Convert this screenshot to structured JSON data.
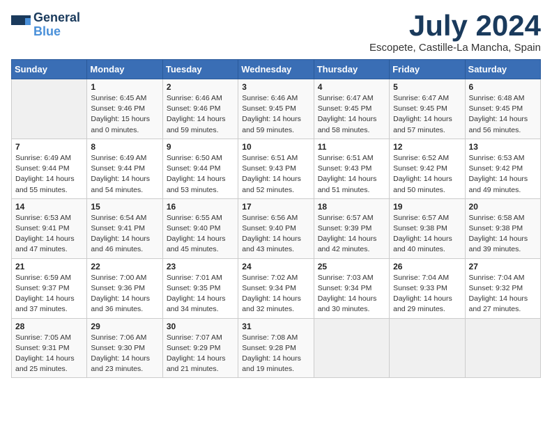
{
  "header": {
    "logo_line1": "General",
    "logo_line2": "Blue",
    "month": "July 2024",
    "location": "Escopete, Castille-La Mancha, Spain"
  },
  "weekdays": [
    "Sunday",
    "Monday",
    "Tuesday",
    "Wednesday",
    "Thursday",
    "Friday",
    "Saturday"
  ],
  "weeks": [
    [
      {
        "day": "",
        "info": ""
      },
      {
        "day": "1",
        "info": "Sunrise: 6:45 AM\nSunset: 9:46 PM\nDaylight: 15 hours\nand 0 minutes."
      },
      {
        "day": "2",
        "info": "Sunrise: 6:46 AM\nSunset: 9:46 PM\nDaylight: 14 hours\nand 59 minutes."
      },
      {
        "day": "3",
        "info": "Sunrise: 6:46 AM\nSunset: 9:45 PM\nDaylight: 14 hours\nand 59 minutes."
      },
      {
        "day": "4",
        "info": "Sunrise: 6:47 AM\nSunset: 9:45 PM\nDaylight: 14 hours\nand 58 minutes."
      },
      {
        "day": "5",
        "info": "Sunrise: 6:47 AM\nSunset: 9:45 PM\nDaylight: 14 hours\nand 57 minutes."
      },
      {
        "day": "6",
        "info": "Sunrise: 6:48 AM\nSunset: 9:45 PM\nDaylight: 14 hours\nand 56 minutes."
      }
    ],
    [
      {
        "day": "7",
        "info": "Sunrise: 6:49 AM\nSunset: 9:44 PM\nDaylight: 14 hours\nand 55 minutes."
      },
      {
        "day": "8",
        "info": "Sunrise: 6:49 AM\nSunset: 9:44 PM\nDaylight: 14 hours\nand 54 minutes."
      },
      {
        "day": "9",
        "info": "Sunrise: 6:50 AM\nSunset: 9:44 PM\nDaylight: 14 hours\nand 53 minutes."
      },
      {
        "day": "10",
        "info": "Sunrise: 6:51 AM\nSunset: 9:43 PM\nDaylight: 14 hours\nand 52 minutes."
      },
      {
        "day": "11",
        "info": "Sunrise: 6:51 AM\nSunset: 9:43 PM\nDaylight: 14 hours\nand 51 minutes."
      },
      {
        "day": "12",
        "info": "Sunrise: 6:52 AM\nSunset: 9:42 PM\nDaylight: 14 hours\nand 50 minutes."
      },
      {
        "day": "13",
        "info": "Sunrise: 6:53 AM\nSunset: 9:42 PM\nDaylight: 14 hours\nand 49 minutes."
      }
    ],
    [
      {
        "day": "14",
        "info": "Sunrise: 6:53 AM\nSunset: 9:41 PM\nDaylight: 14 hours\nand 47 minutes."
      },
      {
        "day": "15",
        "info": "Sunrise: 6:54 AM\nSunset: 9:41 PM\nDaylight: 14 hours\nand 46 minutes."
      },
      {
        "day": "16",
        "info": "Sunrise: 6:55 AM\nSunset: 9:40 PM\nDaylight: 14 hours\nand 45 minutes."
      },
      {
        "day": "17",
        "info": "Sunrise: 6:56 AM\nSunset: 9:40 PM\nDaylight: 14 hours\nand 43 minutes."
      },
      {
        "day": "18",
        "info": "Sunrise: 6:57 AM\nSunset: 9:39 PM\nDaylight: 14 hours\nand 42 minutes."
      },
      {
        "day": "19",
        "info": "Sunrise: 6:57 AM\nSunset: 9:38 PM\nDaylight: 14 hours\nand 40 minutes."
      },
      {
        "day": "20",
        "info": "Sunrise: 6:58 AM\nSunset: 9:38 PM\nDaylight: 14 hours\nand 39 minutes."
      }
    ],
    [
      {
        "day": "21",
        "info": "Sunrise: 6:59 AM\nSunset: 9:37 PM\nDaylight: 14 hours\nand 37 minutes."
      },
      {
        "day": "22",
        "info": "Sunrise: 7:00 AM\nSunset: 9:36 PM\nDaylight: 14 hours\nand 36 minutes."
      },
      {
        "day": "23",
        "info": "Sunrise: 7:01 AM\nSunset: 9:35 PM\nDaylight: 14 hours\nand 34 minutes."
      },
      {
        "day": "24",
        "info": "Sunrise: 7:02 AM\nSunset: 9:34 PM\nDaylight: 14 hours\nand 32 minutes."
      },
      {
        "day": "25",
        "info": "Sunrise: 7:03 AM\nSunset: 9:34 PM\nDaylight: 14 hours\nand 30 minutes."
      },
      {
        "day": "26",
        "info": "Sunrise: 7:04 AM\nSunset: 9:33 PM\nDaylight: 14 hours\nand 29 minutes."
      },
      {
        "day": "27",
        "info": "Sunrise: 7:04 AM\nSunset: 9:32 PM\nDaylight: 14 hours\nand 27 minutes."
      }
    ],
    [
      {
        "day": "28",
        "info": "Sunrise: 7:05 AM\nSunset: 9:31 PM\nDaylight: 14 hours\nand 25 minutes."
      },
      {
        "day": "29",
        "info": "Sunrise: 7:06 AM\nSunset: 9:30 PM\nDaylight: 14 hours\nand 23 minutes."
      },
      {
        "day": "30",
        "info": "Sunrise: 7:07 AM\nSunset: 9:29 PM\nDaylight: 14 hours\nand 21 minutes."
      },
      {
        "day": "31",
        "info": "Sunrise: 7:08 AM\nSunset: 9:28 PM\nDaylight: 14 hours\nand 19 minutes."
      },
      {
        "day": "",
        "info": ""
      },
      {
        "day": "",
        "info": ""
      },
      {
        "day": "",
        "info": ""
      }
    ]
  ]
}
